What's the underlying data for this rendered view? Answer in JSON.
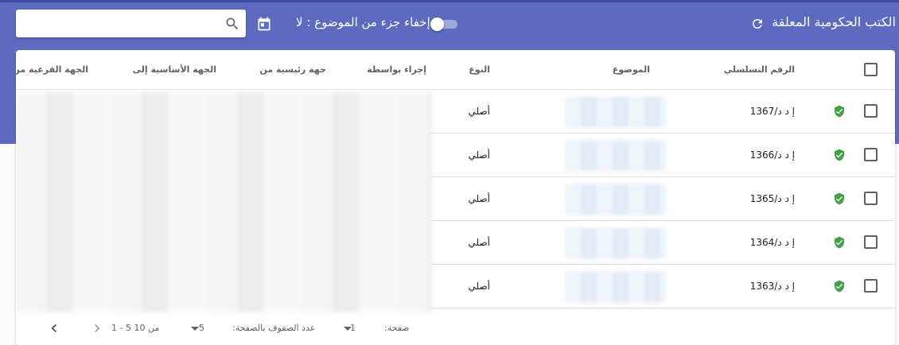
{
  "header": {
    "title": "الكتب الحكومية المعلقة",
    "refresh_icon": "refresh-icon",
    "toggle_label": "إخفاء جزء من الموضوع : لا",
    "toggle_on": false,
    "calendar_icon": "calendar-icon",
    "search": {
      "value": "",
      "placeholder": "",
      "icon": "search-icon"
    },
    "colors": {
      "banner": "#5c6bc0",
      "accent": "#43a047"
    }
  },
  "table": {
    "columns": [
      "الرقم التسلسلي",
      "الموضوع",
      "النوع",
      "إجراء بواسطة",
      "جهة رئيسية من",
      "الجهة الأساسية إلى",
      "الجهة الفرعية من"
    ],
    "rows": [
      {
        "serial": "إ د د/1367",
        "type": "أصلي",
        "icon": "shield-check-icon"
      },
      {
        "serial": "إ د د/1366",
        "type": "أصلي",
        "icon": "shield-check-icon"
      },
      {
        "serial": "إ د د/1365",
        "type": "أصلي",
        "icon": "shield-check-icon"
      },
      {
        "serial": "إ د د/1364",
        "type": "أصلي",
        "icon": "shield-check-icon"
      },
      {
        "serial": "إ د د/1363",
        "type": "أصلي",
        "icon": "shield-check-icon"
      }
    ]
  },
  "pagination": {
    "page_label": "صفحة:",
    "page_value": "1",
    "rows_label": "عدد الصفوف بالصفحة:",
    "rows_value": "5",
    "range_text": "1 - 5 من 10"
  }
}
